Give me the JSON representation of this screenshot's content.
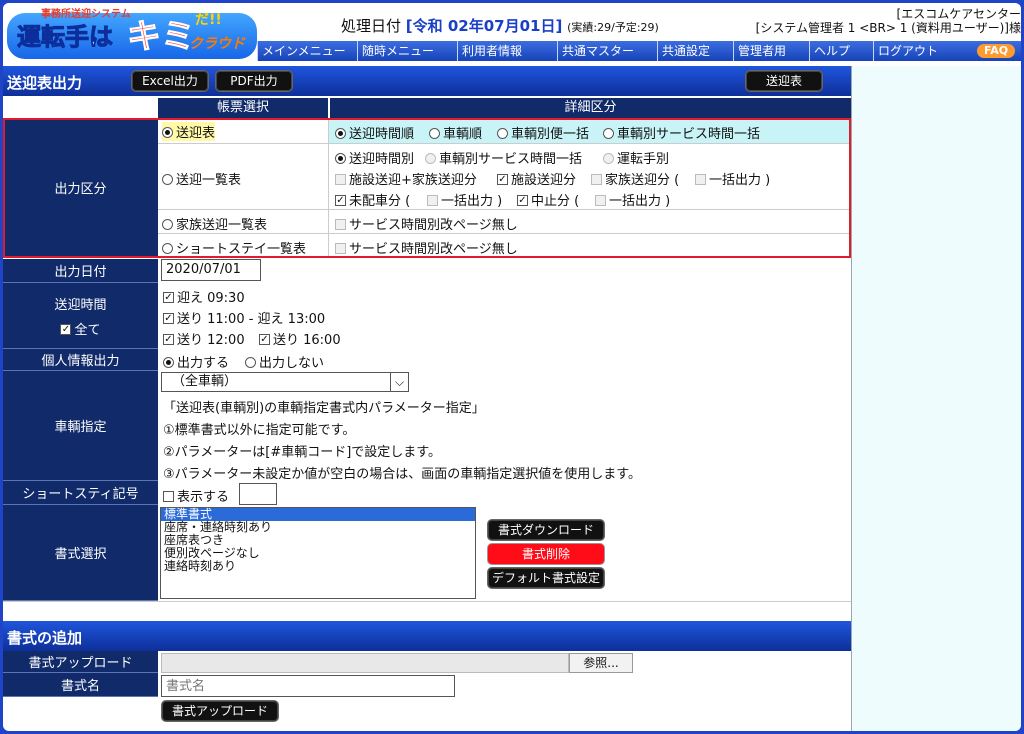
{
  "header": {
    "logo_sub": "事務所送迎システム",
    "logo_main1": "運転手は",
    "logo_main2": "キミ",
    "logo_main3": "だ!!",
    "logo_main4": "クラウド",
    "proc_label": "処理日付",
    "proc_date": "[令和 02年07月01日]",
    "proc_counts": "(実績:29/予定:29)",
    "company_line1": "[エスコムケアセンター",
    "company_line2": "[システム管理者 1 <BR> 1 (資料用ユーザー)]様"
  },
  "menu": [
    "メインメニュー",
    "随時メニュー",
    "利用者情報",
    "共通マスター",
    "共通設定",
    "管理者用",
    "ヘルプ",
    "ログアウト"
  ],
  "faq_label": "FAQ",
  "titlebar": {
    "title": "送迎表出力",
    "excel": "Excel出力",
    "pdf": "PDF出力",
    "sougei": "送迎表"
  },
  "table_header": {
    "col1": "帳票選択",
    "col2": "詳細区分"
  },
  "output_kubun": {
    "label": "出力区分",
    "opt1": "送迎表",
    "opt1_detail": [
      "送迎時間順",
      "車輌順",
      "車輌別便一括",
      "車輌別サービス時間一括"
    ],
    "opt2": "送迎一覧表",
    "opt2_line1": [
      "送迎時間別",
      "車輌別サービス時間一括",
      "運転手別"
    ],
    "opt2_line2": [
      "施設送迎+家族送迎分",
      "施設送迎分",
      "家族送迎分 (",
      "一括出力 )"
    ],
    "opt2_line3": [
      "未配車分 (",
      "一括出力 )",
      "中止分 (",
      "一括出力 )"
    ],
    "opt3": "家族送迎一覧表",
    "opt3_detail": "サービス時間別改ページ無し",
    "opt4": "ショートステイ一覧表",
    "opt4_detail": "サービス時間別改ページ無し"
  },
  "output_date": {
    "label": "出力日付",
    "value": "2020/07/01"
  },
  "sougei_time": {
    "label": "送迎時間",
    "all": "全て",
    "items": [
      "迎え 09:30",
      "送り 11:00 - 迎え 13:00",
      "送り 12:00",
      "送り 16:00"
    ]
  },
  "personal": {
    "label": "個人情報出力",
    "on": "出力する",
    "off": "出力しない"
  },
  "vehicle": {
    "label": "車輌指定",
    "selected": "（全車輌）",
    "notes": [
      "「送迎表(車輌別)の車輌指定書式内パラメーター指定」",
      "①標準書式以外に指定可能です。",
      "②パラメーターは[#車輌コード]で設定します。",
      "③パラメーター未設定か値が空白の場合は、画面の車輌指定選択値を使用します。"
    ]
  },
  "shortstay": {
    "label": "ショートスティ記号",
    "show": "表示する"
  },
  "format": {
    "label": "書式選択",
    "options": [
      "標準書式",
      "座席・連絡時刻あり",
      "座席表つき",
      "便別改ページなし",
      "連絡時刻あり"
    ],
    "download": "書式ダウンロード",
    "delete": "書式削除",
    "default": "デフォルト書式設定"
  },
  "add_format": {
    "title": "書式の追加",
    "upload_label": "書式アップロード",
    "browse": "参照...",
    "name_label": "書式名",
    "name_placeholder": "書式名",
    "upload_button": "書式アップロード"
  }
}
